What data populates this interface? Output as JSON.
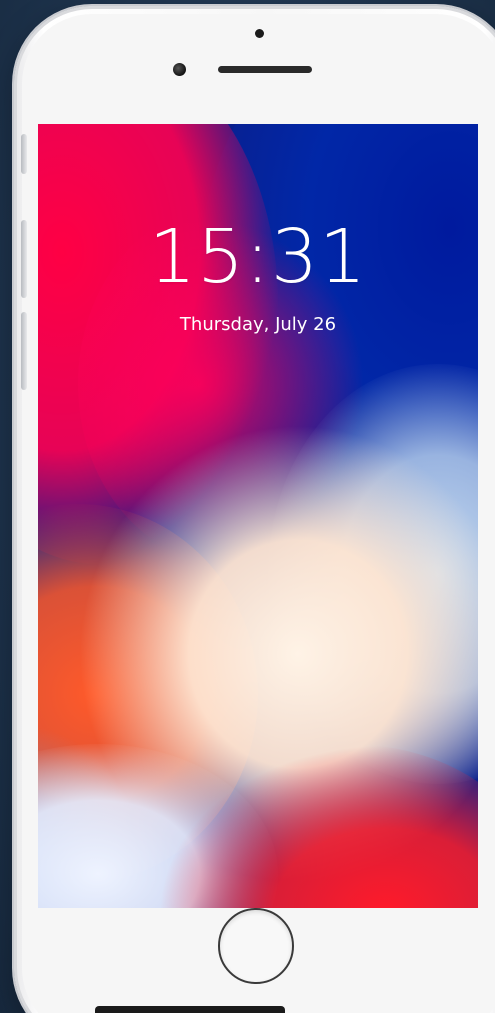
{
  "device": {
    "body_color": "#f7f7f7",
    "frame_color": "#d9dadd",
    "home_button_icon": "home-button-circle",
    "camera_icon": "front-camera",
    "earpiece_icon": "speaker-grille"
  },
  "lock_screen": {
    "time": "15:31",
    "date": "Thursday, July 26",
    "wallpaper_colors": [
      "#ff0044",
      "#001a9e",
      "#fff3e6",
      "#ff5a2a",
      "#c6dcf2",
      "#ff1a2a"
    ]
  }
}
